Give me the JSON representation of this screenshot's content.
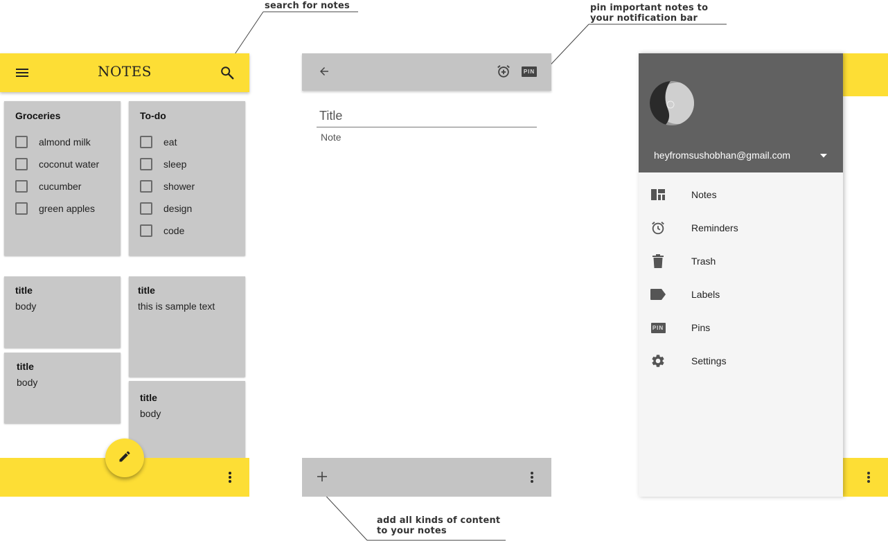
{
  "annotations": {
    "search": "search for notes",
    "pin": "pin important notes to your notification bar",
    "add": "add all kinds of content to your notes"
  },
  "screen1": {
    "app_title": "NOTES",
    "icons": {
      "menu": "menu-icon",
      "search": "search-icon",
      "more": "more-vert-icon",
      "fab": "pencil-icon"
    },
    "checklists": [
      {
        "title": "Groceries",
        "items": [
          "almond milk",
          "coconut water",
          "cucumber",
          "green apples"
        ]
      },
      {
        "title": "To-do",
        "items": [
          "eat",
          "sleep",
          "shower",
          "design",
          "code"
        ]
      }
    ],
    "notes": [
      {
        "title": "title",
        "body": "body"
      },
      {
        "title": "title",
        "body": "this is sample text"
      },
      {
        "title": "title",
        "body": "body"
      },
      {
        "title": "title",
        "body": "body"
      }
    ]
  },
  "screen2": {
    "title_placeholder": "Title",
    "note_placeholder": "Note",
    "icons": {
      "back": "arrow-back-icon",
      "reminder": "alarm-add-icon",
      "pin": "pin-icon",
      "add": "plus-icon",
      "more": "more-vert-icon"
    },
    "pin_badge": "PIN"
  },
  "screen3": {
    "email": "heyfromsushobhan@gmail.com",
    "menu": [
      {
        "label": "Notes",
        "icon": "dashboard-icon"
      },
      {
        "label": "Reminders",
        "icon": "alarm-icon"
      },
      {
        "label": "Trash",
        "icon": "trash-icon"
      },
      {
        "label": "Labels",
        "icon": "label-icon"
      },
      {
        "label": "Pins",
        "icon": "pin-icon"
      },
      {
        "label": "Settings",
        "icon": "gear-icon"
      }
    ],
    "pin_badge": "PIN"
  },
  "colors": {
    "accent_yellow": "#fdde35",
    "card_gray": "#c8c8c8",
    "toolbar_gray": "#c4c4c4",
    "drawer_header": "#616161",
    "drawer_bg": "#f5f5f5"
  }
}
